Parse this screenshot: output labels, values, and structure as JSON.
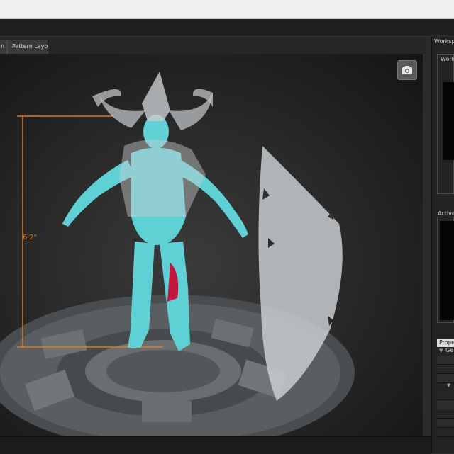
{
  "tabs": [
    {
      "label": "n"
    },
    {
      "label": "Pattern Layout"
    }
  ],
  "viewport": {
    "measurement_label": "6'2\"",
    "snapshot_button_icon": "camera-icon"
  },
  "right_panel": {
    "workspace_title": "Worksp",
    "workspace_box_title": "Worksp",
    "active_title": "Active T",
    "property_header": "Propert",
    "general_label": "Ge"
  },
  "colors": {
    "background": "#2b2b2b",
    "avatar": "#5fd0d6",
    "garment": "#c9cdd0",
    "measure_line": "#e07b22",
    "highlight": "#c4173e"
  }
}
